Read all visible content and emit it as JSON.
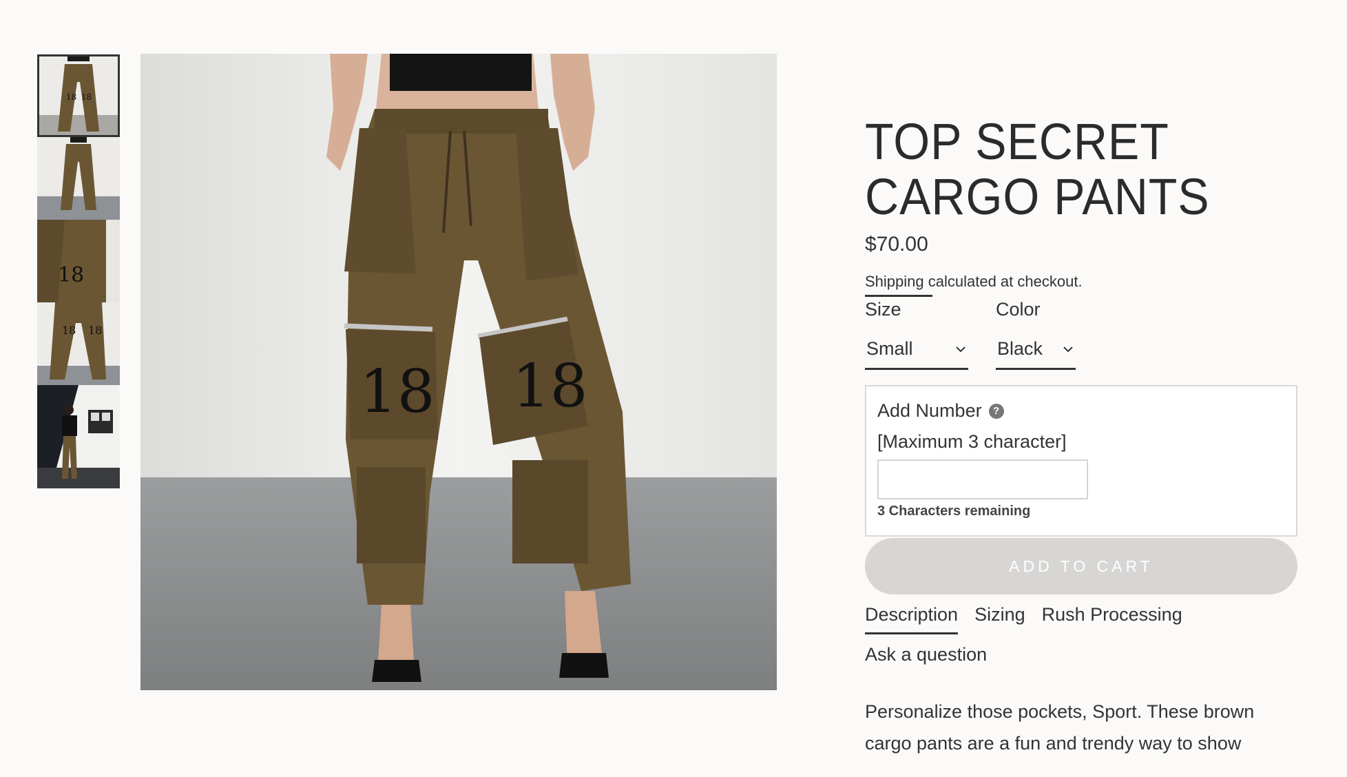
{
  "product": {
    "title": "TOP SECRET CARGO PANTS",
    "price": "$70.00",
    "shipping_link": "Shipping",
    "shipping_rest": " calculated at checkout.",
    "description": "Personalize those pockets, Sport. These brown cargo pants are a fun and trendy way to show"
  },
  "options": {
    "size_label": "Size",
    "size_value": "Small",
    "color_label": "Color",
    "color_value": "Black"
  },
  "custom": {
    "label": "Add Number",
    "help": "?",
    "sub": "[Maximum 3 character]",
    "input_value": "",
    "remaining": "3 Characters remaining"
  },
  "cart": {
    "label": "ADD TO CART"
  },
  "tabs": [
    "Description",
    "Sizing",
    "Rush Processing",
    "Ask a question"
  ],
  "main_image": {
    "pocket_numbers": [
      "18",
      "18"
    ]
  },
  "thumbnails": [
    "thumb-front",
    "thumb-full",
    "thumb-detail",
    "thumb-side",
    "thumb-street"
  ],
  "colors": {
    "pants": "#6b5634",
    "button": "#d8d6d4",
    "background": "#fbfaf9"
  }
}
